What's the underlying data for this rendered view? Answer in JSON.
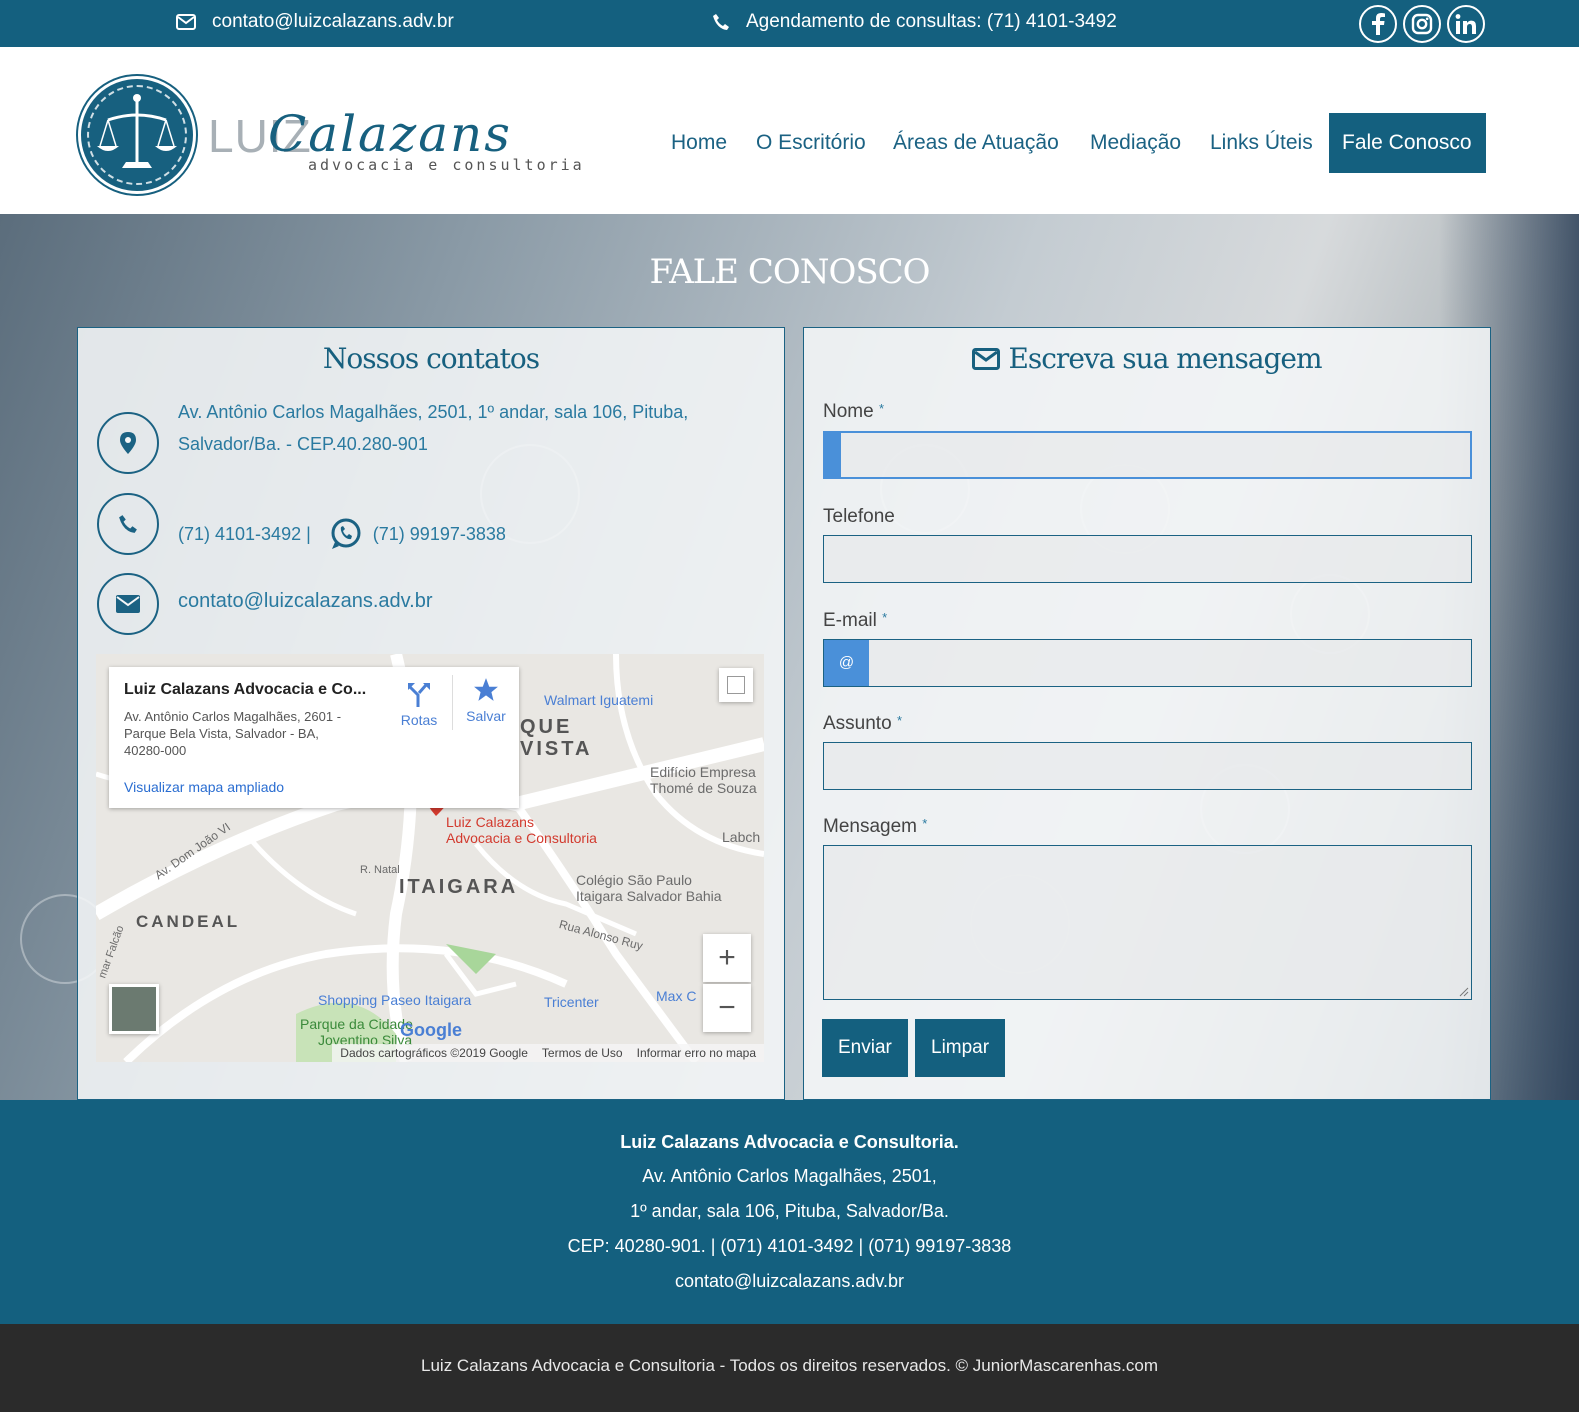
{
  "topbar": {
    "email": "contato@luizcalazans.adv.br",
    "phone": "Agendamento de consultas: (71) 4101-3492",
    "social": [
      "facebook-icon",
      "instagram-icon",
      "linkedin-icon"
    ]
  },
  "logo": {
    "name_a": "LUIZ",
    "name_b": "Calazans",
    "tagline": "advocacia e consultoria"
  },
  "nav": {
    "items": [
      "Home",
      "O Escritório",
      "Áreas de Atuação",
      "Mediação",
      "Links Úteis",
      "Fale Conosco"
    ],
    "active": "Fale Conosco"
  },
  "hero": {
    "title": "FALE CONOSCO"
  },
  "contacts": {
    "title": "Nossos contatos",
    "address_line1": "Av. Antônio Carlos Magalhães, 2501, 1º andar, sala 106, Pituba,",
    "address_line2": "Salvador/Ba. - CEP.40.280-901",
    "phone": "(71) 4101-3492 |",
    "whatsapp": "(71) 99197-3838",
    "email": "contato@luizcalazans.adv.br"
  },
  "map": {
    "place_name": "Luiz Calazans Advocacia e Co...",
    "address_line1": "Av. Antônio Carlos Magalhães, 2601 -",
    "address_line2": "Parque Bela Vista, Salvador - BA,",
    "address_line3": "40280-000",
    "directions_label": "Rotas",
    "save_label": "Salvar",
    "larger_map_link": "Visualizar mapa ampliado",
    "marker_line1": "Luiz Calazans",
    "marker_line2": "Advocacia e Consultoria",
    "labels": {
      "walmart": "Walmart Iguatemi",
      "parque": "QUE",
      "vista": "VISTA",
      "edificio1": "Edifício Empresa",
      "edificio2": "Thomé de Souza",
      "labch": "Labch",
      "itaigara": "ITAIGARA",
      "colegio1": "Colégio São Paulo",
      "colegio2": "Itaigara Salvador Bahia",
      "candeal": "CANDEAL",
      "domjoao": "Av. Dom João VI",
      "natal": "R. Natal",
      "alonso": "Rua Alonso Ruy",
      "falcao": "mar Falcão",
      "shopping": "Shopping Paseo Itaigara",
      "tricenter": "Tricenter",
      "maxc": "Max C",
      "parque_cidade1": "Parque da Cidade",
      "parque_cidade2": "Joventino Silva",
      "google": "Google"
    },
    "footer_data": "Dados cartográficos ©2019 Google",
    "footer_terms": "Termos de Uso",
    "footer_report": "Informar erro no mapa",
    "zoom_in": "+",
    "zoom_out": "−"
  },
  "form": {
    "title": "Escreva sua mensagem",
    "name_label": "Nome",
    "phone_label": "Telefone",
    "email_label": "E-mail",
    "email_prefix": "@",
    "subject_label": "Assunto",
    "message_label": "Mensagem",
    "required_mark": "*",
    "send_button": "Enviar",
    "clear_button": "Limpar"
  },
  "footer": {
    "company": "Luiz Calazans Advocacia e Consultoria.",
    "line1": "Av. Antônio Carlos Magalhães, 2501,",
    "line2": "1º andar, sala 106, Pituba, Salvador/Ba.",
    "line3": "CEP: 40280-901. | (071) 4101-3492 | (071) 99197-3838",
    "email": "contato@luizcalazans.adv.br"
  },
  "copyright": "Luiz Calazans Advocacia e Consultoria - Todos os direitos reservados. © JuniorMascarenhas.com"
}
